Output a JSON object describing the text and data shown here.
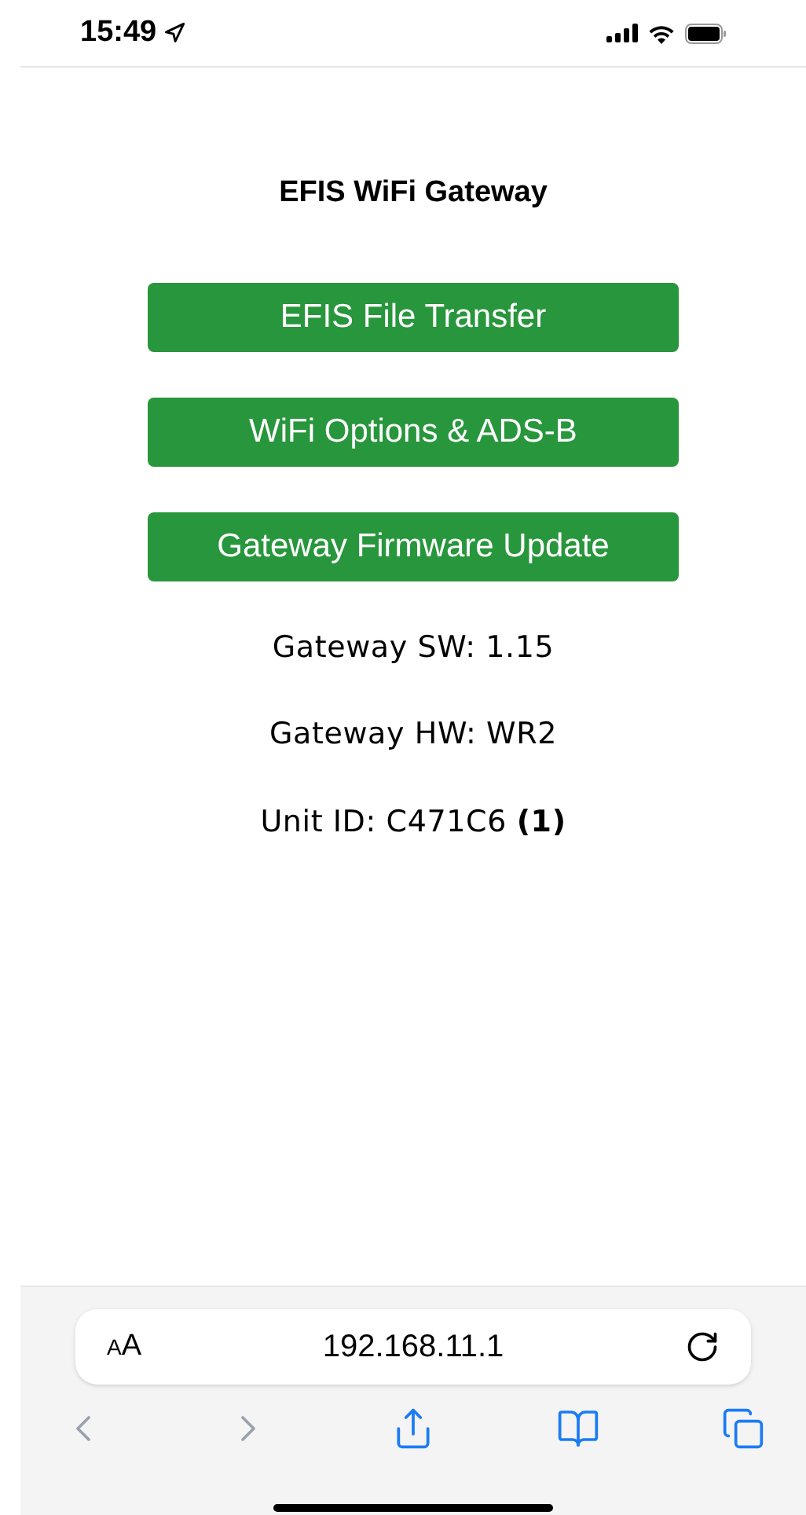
{
  "status_bar": {
    "time": "15:49"
  },
  "page": {
    "title": "EFIS WiFi Gateway",
    "buttons": [
      "EFIS File Transfer",
      "WiFi Options & ADS-B",
      "Gateway Firmware Update"
    ],
    "info": [
      "Gateway SW: 1.15",
      "Gateway HW: WR2",
      "Unit ID: C471C6 **(1)**"
    ]
  },
  "browser": {
    "text_size": "AA",
    "address": "192.168.11.1",
    "toolbar": [
      {
        "kind": "back",
        "disabled": true
      },
      {
        "kind": "forward",
        "disabled": true
      },
      {
        "kind": "share",
        "disabled": false
      },
      {
        "kind": "bookmarks",
        "disabled": false
      },
      {
        "kind": "tabs",
        "disabled": false
      }
    ]
  }
}
